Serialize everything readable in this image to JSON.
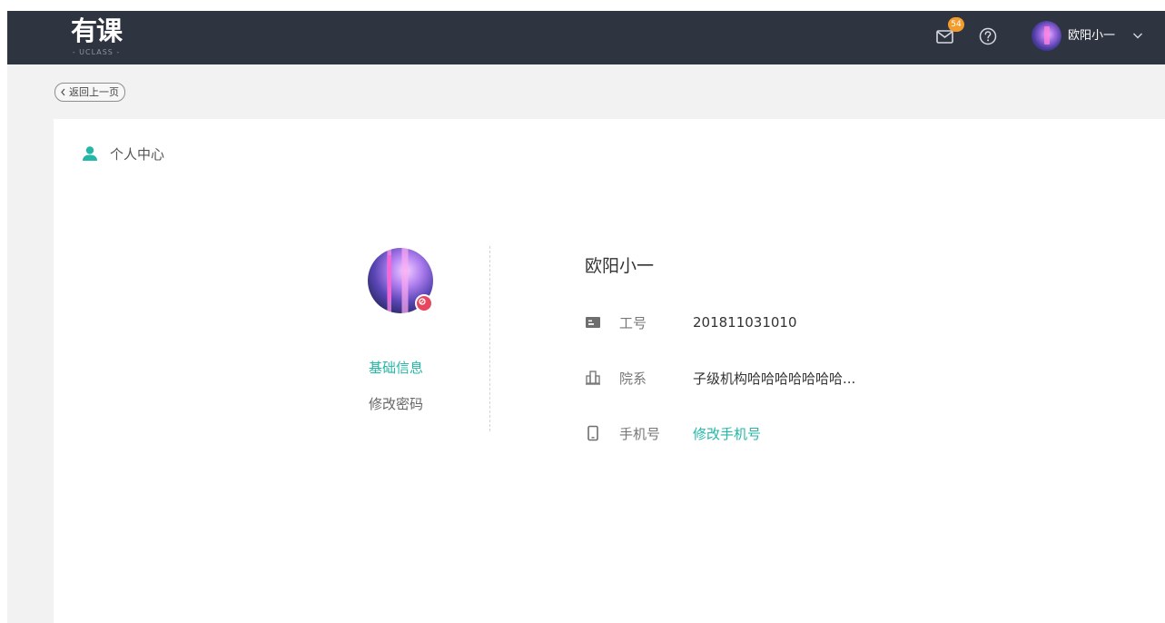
{
  "header": {
    "logo_main": "有课",
    "logo_sub": "- UCLASS -",
    "mail_icon": "mail-icon",
    "notification_count": "54",
    "help_icon": "help-circle-icon",
    "user_name": "欧阳小一",
    "caret_icon": "chevron-down-icon"
  },
  "back_button": {
    "label": "返回上一页",
    "icon": "chevron-left-icon"
  },
  "panel": {
    "title": "个人中心",
    "title_icon": "person-icon"
  },
  "side_nav": [
    {
      "label": "基础信息",
      "active": true
    },
    {
      "label": "修改密码",
      "active": false
    }
  ],
  "profile": {
    "name": "欧阳小一",
    "rows": [
      {
        "icon": "id-card-icon",
        "label": "工号",
        "value": "201811031010"
      },
      {
        "icon": "building-icon",
        "label": "院系",
        "value": "子级机构哈哈哈哈哈哈哈..."
      },
      {
        "icon": "phone-icon",
        "label": "手机号",
        "link": "修改手机号"
      }
    ]
  },
  "colors": {
    "topbar": "#2f3441",
    "accent": "#23b7a6",
    "badge": "#f39c2c",
    "edit_badge": "#e8465e",
    "background": "#f2f2f2"
  }
}
